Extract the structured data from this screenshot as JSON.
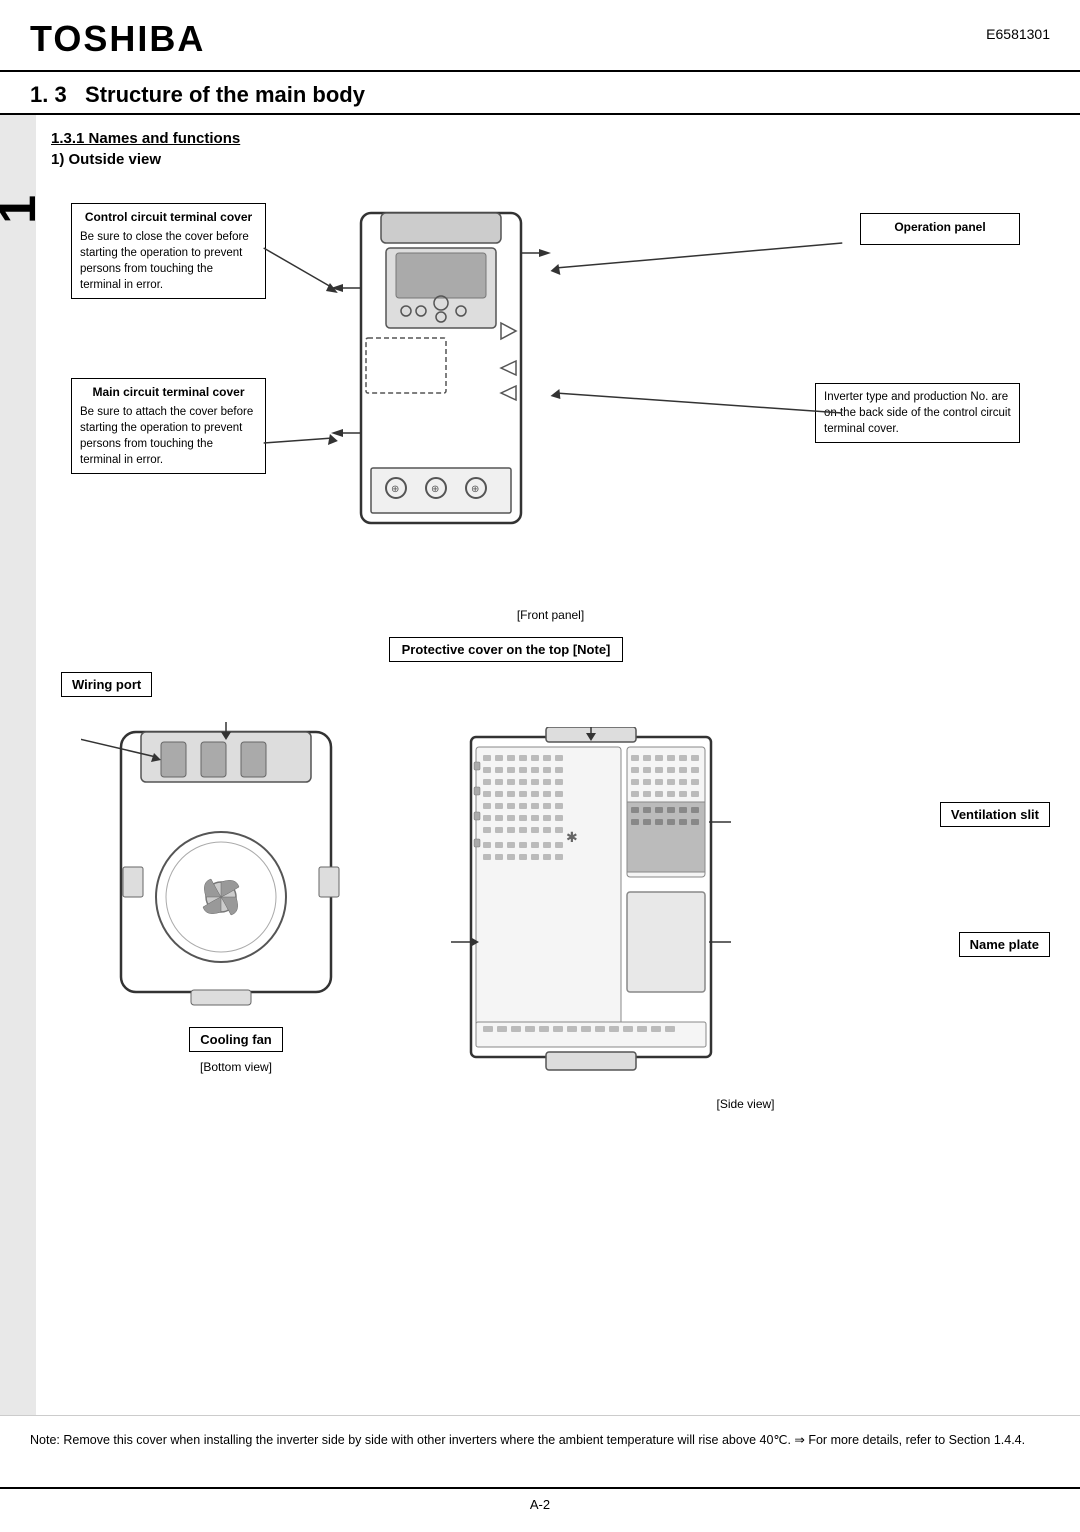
{
  "header": {
    "logo": "TOSHIBA",
    "doc_number": "E6581301"
  },
  "section": {
    "number": "1. 3",
    "title": "Structure of the main body",
    "chapter_num": "1"
  },
  "subsection": {
    "title": "1.3.1  Names  and  functions",
    "subtitle": "1) Outside view"
  },
  "front_panel": {
    "caption": "[Front panel]",
    "callout_control_circuit": {
      "title": "Control circuit terminal cover",
      "text": "Be sure to close the cover before starting the operation to prevent persons from touching the terminal in error."
    },
    "callout_main_circuit": {
      "title": "Main circuit terminal cover",
      "text": "Be sure to attach the cover before starting the operation to prevent persons from touching the terminal in error."
    },
    "callout_operation_panel": {
      "title": "Operation panel"
    },
    "callout_inverter_info": {
      "text": "Inverter type and production No. are on the back side of the control circuit terminal cover."
    }
  },
  "bottom_views": {
    "protective_cover_label": "Protective cover on the top [Note]",
    "wiring_port_label": "Wiring port",
    "cooling_fan_label": "Cooling fan",
    "ventilation_slit_label": "Ventilation slit",
    "name_plate_label": "Name plate",
    "bottom_caption": "[Bottom view]",
    "side_caption": "[Side view]"
  },
  "note": {
    "text": "Note: Remove this cover when installing the inverter side by side with other inverters where the ambient temperature will rise above 40℃.   ⇒ For more details, refer to Section 1.4.4."
  },
  "footer": {
    "page": "A-2"
  }
}
